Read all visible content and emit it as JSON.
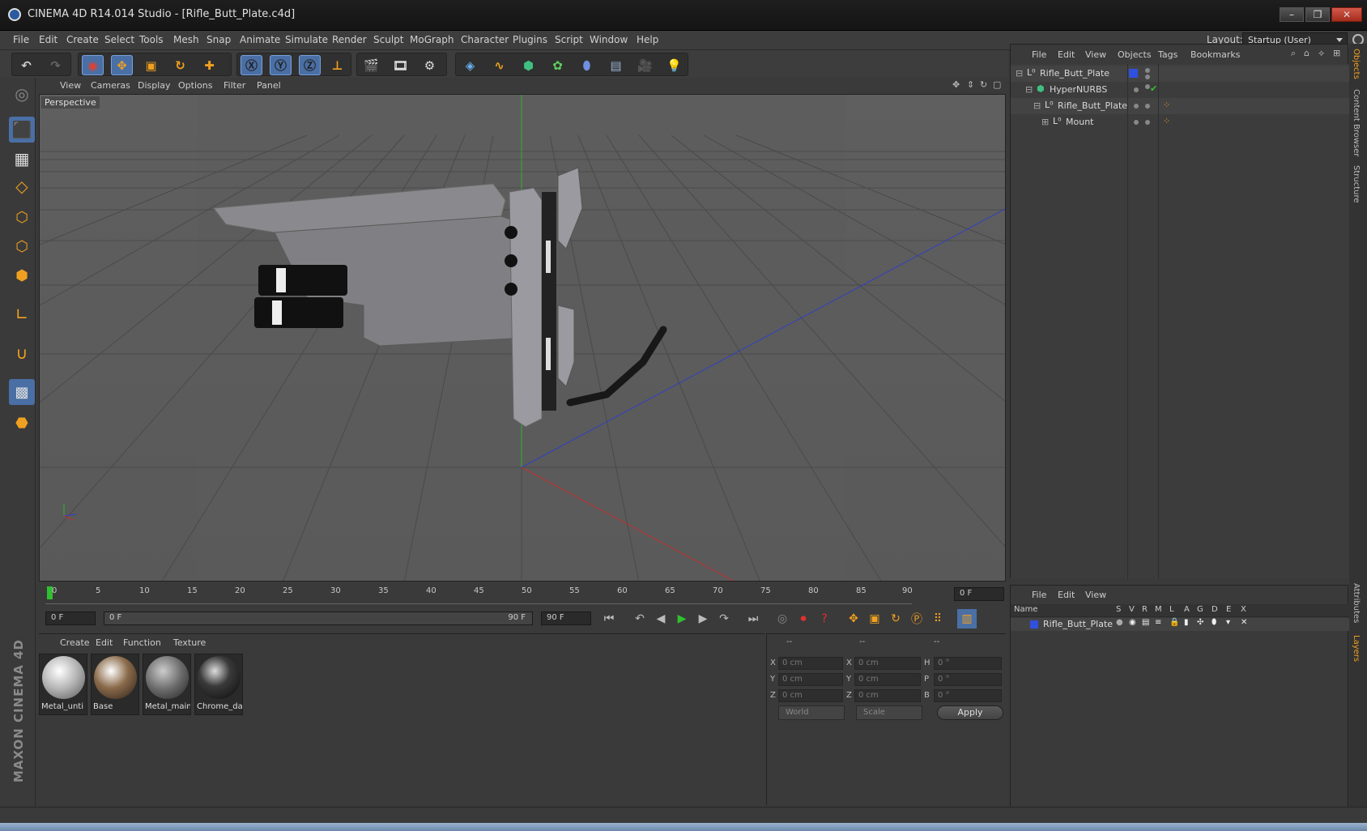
{
  "window": {
    "title": "CINEMA 4D R14.014 Studio - [Rifle_Butt_Plate.c4d]",
    "controls": [
      "minimize-icon",
      "restore-icon",
      "close-icon"
    ]
  },
  "menubar": {
    "items": [
      "File",
      "Edit",
      "Create",
      "Select",
      "Tools",
      "Mesh",
      "Snap",
      "Animate",
      "Simulate",
      "Render",
      "Sculpt",
      "MoGraph",
      "Character",
      "Plugins",
      "Script",
      "Window",
      "Help"
    ],
    "layout_label": "Layout:",
    "layout_value": "Startup (User)"
  },
  "viewport": {
    "menu": [
      "View",
      "Cameras",
      "Display",
      "Options",
      "Filter",
      "Panel"
    ],
    "label": "Perspective",
    "axis_y": "Y"
  },
  "timeline": {
    "ticks": [
      "0",
      "5",
      "10",
      "15",
      "20",
      "25",
      "30",
      "35",
      "40",
      "45",
      "50",
      "55",
      "60",
      "65",
      "70",
      "75",
      "80",
      "85",
      "90"
    ],
    "current_frame": "0 F",
    "start_frame": "0 F",
    "range_start": "0 F",
    "range_end": "90 F",
    "end_frame": "90 F"
  },
  "materials": {
    "menu": [
      "Create",
      "Edit",
      "Function",
      "Texture"
    ],
    "items": [
      {
        "name": "Metal_unti",
        "color": "#c8c8c8"
      },
      {
        "name": "Base",
        "color": "#8a6a4a"
      },
      {
        "name": "Metal_main",
        "color": "#6a6a6a"
      },
      {
        "name": "Chrome_da",
        "color": "#2a2a2a"
      }
    ]
  },
  "coordinates": {
    "headers": [
      "--",
      "--",
      "--"
    ],
    "rows": [
      {
        "l1": "X",
        "v1": "0 cm",
        "l2": "X",
        "v2": "0 cm",
        "l3": "H",
        "v3": "0 °"
      },
      {
        "l1": "Y",
        "v1": "0 cm",
        "l2": "Y",
        "v2": "0 cm",
        "l3": "P",
        "v3": "0 °"
      },
      {
        "l1": "Z",
        "v1": "0 cm",
        "l2": "Z",
        "v2": "0 cm",
        "l3": "B",
        "v3": "0 °"
      }
    ],
    "space": "World",
    "mode": "Scale",
    "apply": "Apply"
  },
  "objects": {
    "menu": [
      "File",
      "Edit",
      "View",
      "Objects",
      "Tags",
      "Bookmarks"
    ],
    "tree": [
      {
        "name": "Rifle_Butt_Plate",
        "indent": 0
      },
      {
        "name": "HyperNURBS",
        "indent": 1
      },
      {
        "name": "Rifle_Butt_Plate",
        "indent": 2
      },
      {
        "name": "Mount",
        "indent": 3
      }
    ]
  },
  "layers": {
    "menu": [
      "File",
      "Edit",
      "View"
    ],
    "columns": [
      "Name",
      "S",
      "V",
      "R",
      "M",
      "L",
      "A",
      "G",
      "D",
      "E",
      "X"
    ],
    "rows": [
      {
        "name": "Rifle_Butt_Plate",
        "color": "#3050e0"
      }
    ]
  },
  "side_tabs": [
    "Objects",
    "Content Browser",
    "Structure",
    "Attributes",
    "Layers"
  ],
  "branding": "MAXON CINEMA 4D",
  "colors": {
    "accent_blue": "#4a6fa5",
    "axis_x": "#c03030",
    "axis_y": "#30b030",
    "axis_z": "#3040c0",
    "play_green": "#30c030"
  }
}
